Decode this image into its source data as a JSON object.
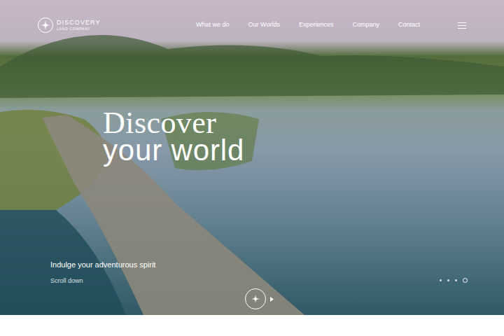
{
  "header": {
    "logo": {
      "name": "DISCOVERY",
      "subtitle": "LAND COMPANY"
    },
    "nav": [
      {
        "label": "What we do"
      },
      {
        "label": "Our Worlds"
      },
      {
        "label": "Experiences"
      },
      {
        "label": "Company"
      },
      {
        "label": "Contact"
      }
    ]
  },
  "hero": {
    "headline": {
      "line1": "Discover",
      "line2": "your world"
    },
    "tagline": "Indulge your adventurous spirit",
    "scroll": "Scroll down",
    "slides": [
      {
        "selected": false
      },
      {
        "selected": false
      },
      {
        "selected": false
      },
      {
        "selected": true
      }
    ]
  }
}
